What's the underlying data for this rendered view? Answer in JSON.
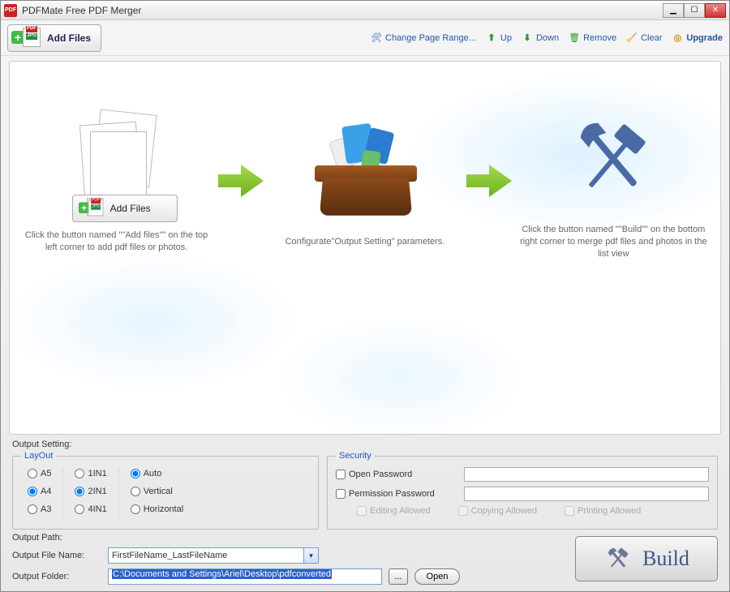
{
  "titlebar": {
    "title": "PDFMate Free PDF Merger"
  },
  "toolbar": {
    "add_files": "Add Files",
    "change_page_range": "Change Page Range...",
    "up": "Up",
    "down": "Down",
    "remove": "Remove",
    "clear": "Clear",
    "upgrade": "Upgrade"
  },
  "steps": {
    "step1_img_label1": "PDF",
    "step1_img_label2": "JPG",
    "step1_button": "Add Files",
    "step1_text": "Click the button named \"\"Add files\"\" on the top left corner to add pdf files or photos.",
    "step2_text": "Configurate\"Output Setting\" parameters.",
    "step3_text": "Click the button named \"\"Build\"\" on the bottom right corner to merge pdf files and photos in the list view"
  },
  "output_setting": {
    "label": "Output Setting:",
    "layout": {
      "legend": "LayOut",
      "a5": "A5",
      "a4": "A4",
      "a3": "A3",
      "in1": "1IN1",
      "in2": "2IN1",
      "in4": "4IN1",
      "auto": "Auto",
      "vertical": "Vertical",
      "horizontal": "Horizontal",
      "paper_selected": "A4",
      "nup_selected": "2IN1",
      "orient_selected": "Auto"
    },
    "security": {
      "legend": "Security",
      "open_password": "Open Password",
      "permission_password": "Permission Password",
      "editing_allowed": "Editing Allowed",
      "copying_allowed": "Copying Allowed",
      "printing_allowed": "Printing Allowed"
    }
  },
  "output_path": {
    "label": "Output Path:",
    "file_name_label": "Output File Name:",
    "file_name_value": "FirstFileName_LastFileName",
    "folder_label": "Output Folder:",
    "folder_value": "C:\\Documents and Settings\\Ariel\\Desktop\\pdfconverted",
    "browse": "...",
    "open": "Open"
  },
  "build": {
    "label": "Build"
  }
}
